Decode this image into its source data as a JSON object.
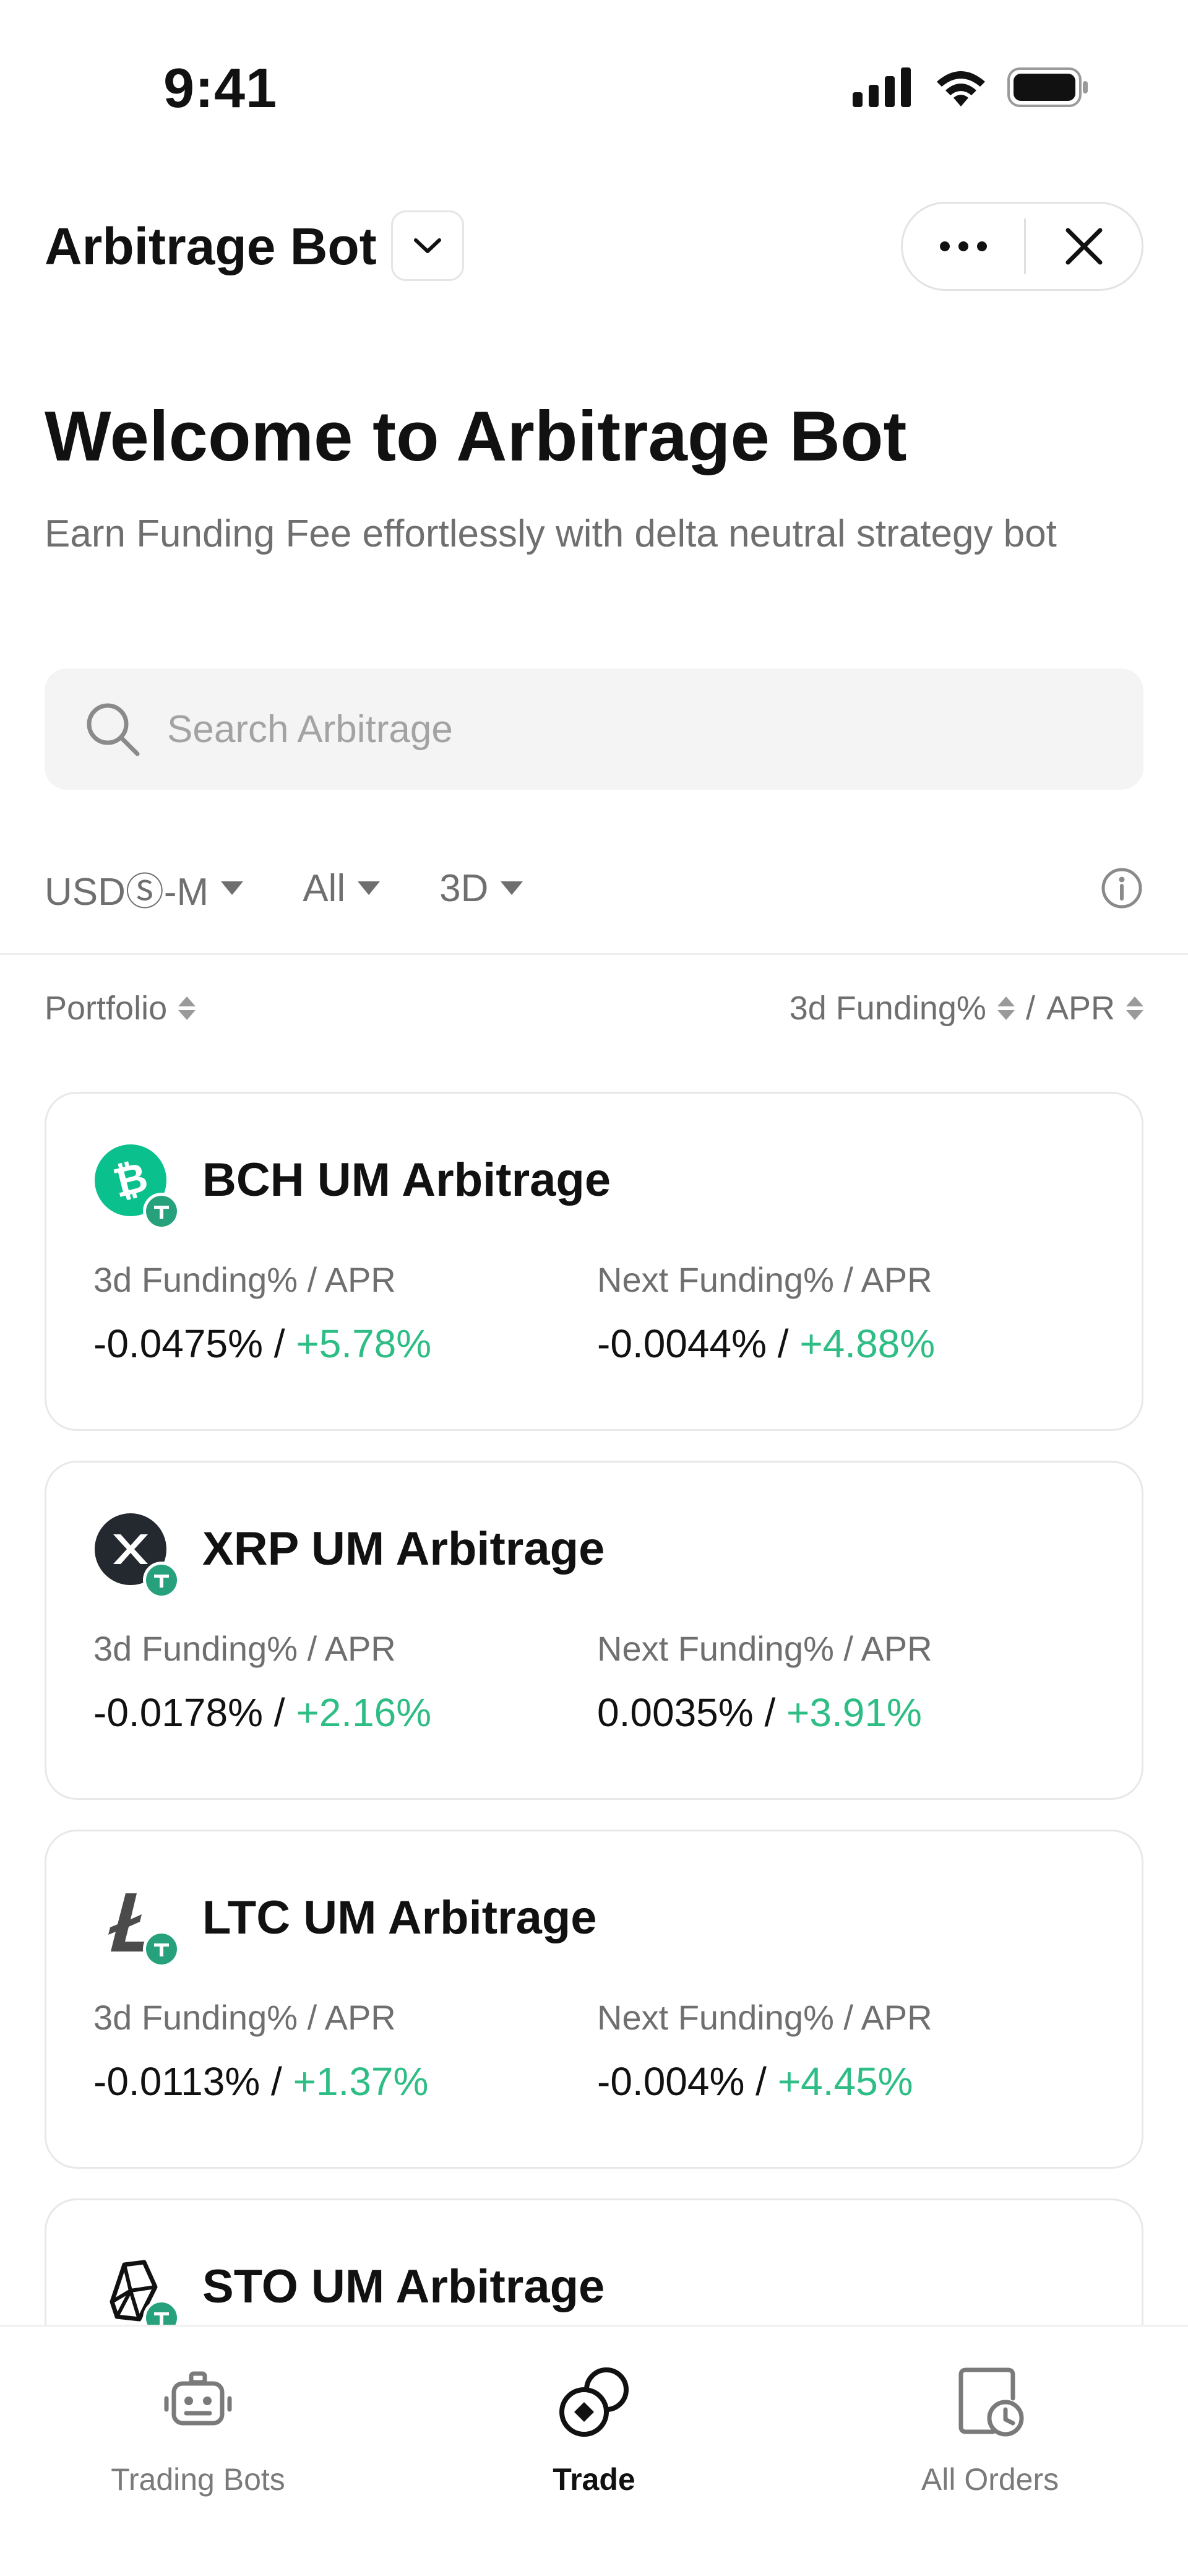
{
  "status_bar": {
    "time": "9:41"
  },
  "header": {
    "title": "Arbitrage Bot"
  },
  "welcome": {
    "title": "Welcome to Arbitrage Bot",
    "subtitle": "Earn Funding Fee effortlessly with delta neutral strategy bot"
  },
  "search": {
    "placeholder": "Search Arbitrage"
  },
  "filters": [
    {
      "label": "USDⓈ-M"
    },
    {
      "label": "All"
    },
    {
      "label": "3D"
    }
  ],
  "sort": {
    "portfolio": "Portfolio",
    "funding": "3d Funding%",
    "separator": "/",
    "apr": "APR"
  },
  "cards": [
    {
      "title": "BCH UM Arbitrage",
      "icon": "bitcoin-cash-icon",
      "col1_label": "3d Funding% / APR",
      "col1_funding": "-0.0475% / ",
      "col1_apr": "+5.78%",
      "col2_label": "Next Funding% / APR",
      "col2_funding": "-0.0044% / ",
      "col2_apr": "+4.88%"
    },
    {
      "title": "XRP UM Arbitrage",
      "icon": "xrp-icon",
      "col1_label": "3d Funding% / APR",
      "col1_funding": "-0.0178% / ",
      "col1_apr": "+2.16%",
      "col2_label": "Next Funding% / APR",
      "col2_funding": "0.0035% / ",
      "col2_apr": "+3.91%"
    },
    {
      "title": "LTC UM Arbitrage",
      "icon": "litecoin-icon",
      "col1_label": "3d Funding% / APR",
      "col1_funding": "-0.0113% / ",
      "col1_apr": "+1.37%",
      "col2_label": "Next Funding% / APR",
      "col2_funding": "-0.004% / ",
      "col2_apr": "+4.45%"
    },
    {
      "title": "STO UM Arbitrage",
      "icon": "sto-icon"
    }
  ],
  "tabs": [
    {
      "label": "Trading Bots",
      "icon": "robot-icon"
    },
    {
      "label": "Trade",
      "icon": "trade-icon",
      "active": true
    },
    {
      "label": "All Orders",
      "icon": "orders-icon"
    }
  ],
  "colors": {
    "positive": "#2ebd85",
    "bch": "#0ac18e",
    "tether": "#26a17b",
    "text_secondary": "#6f6f6f"
  }
}
